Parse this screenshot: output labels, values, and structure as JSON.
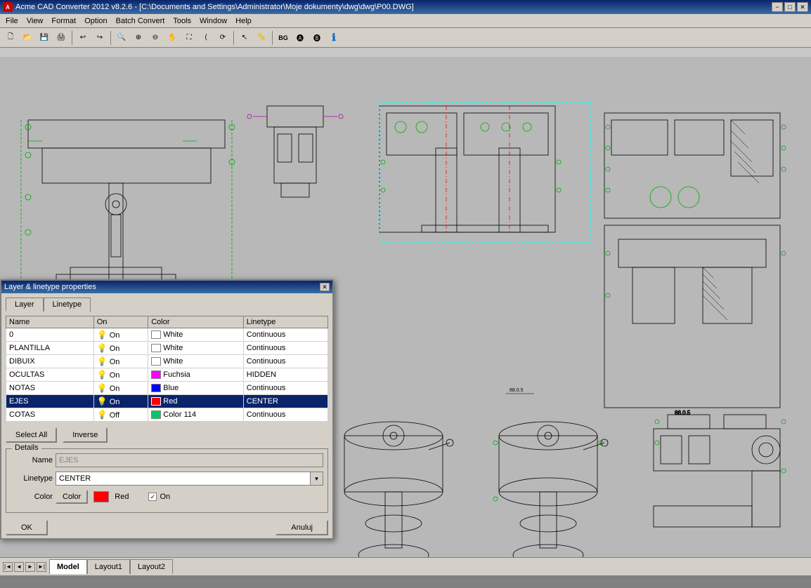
{
  "title": {
    "app_name": "Acme CAD Converter 2012 v8.2.6",
    "file_path": "C:\\Documents and Settings\\Administrator\\Moje dokumenty\\dwg\\dwg\\P00.DWG",
    "full_title": "Acme CAD Converter 2012 v8.2.6 - [C:\\Documents and Settings\\Administrator\\Moje dokumenty\\dwg\\dwg\\P00.DWG]"
  },
  "title_buttons": {
    "minimize": "−",
    "maximize": "□",
    "close": "✕"
  },
  "menu": {
    "items": [
      "File",
      "View",
      "Format",
      "Option",
      "Batch Convert",
      "Tools",
      "Window",
      "Help"
    ]
  },
  "dialog": {
    "title": "Layer & linetype properties",
    "tabs": [
      {
        "label": "Layer",
        "active": true
      },
      {
        "label": "Linetype",
        "active": false
      }
    ],
    "table": {
      "headers": [
        "Name",
        "On",
        "Color",
        "Linetype"
      ],
      "rows": [
        {
          "name": "0",
          "on": "On",
          "color_name": "White",
          "color_hex": "#ffffff",
          "linetype": "Continuous",
          "selected": false
        },
        {
          "name": "PLANTILLA",
          "on": "On",
          "color_name": "White",
          "color_hex": "#ffffff",
          "linetype": "Continuous",
          "selected": false
        },
        {
          "name": "DIBUIX",
          "on": "On",
          "color_name": "White",
          "color_hex": "#ffffff",
          "linetype": "Continuous",
          "selected": false
        },
        {
          "name": "OCULTAS",
          "on": "On",
          "color_name": "Fuchsia",
          "color_hex": "#ff00ff",
          "linetype": "HIDDEN",
          "selected": false
        },
        {
          "name": "NOTAS",
          "on": "On",
          "color_name": "Blue",
          "color_hex": "#0000ff",
          "linetype": "Continuous",
          "selected": false
        },
        {
          "name": "EJES",
          "on": "On",
          "color_name": "Red",
          "color_hex": "#ff0000",
          "linetype": "CENTER",
          "selected": true
        },
        {
          "name": "COTAS",
          "on": "Off",
          "color_name": "Color 114",
          "color_hex": "#00cc66",
          "linetype": "Continuous",
          "selected": false
        }
      ]
    },
    "buttons": {
      "select_all": "Select All",
      "inverse": "Inverse"
    },
    "details": {
      "legend": "Details",
      "name_label": "Name",
      "name_value": "EJES",
      "linetype_label": "Linetype",
      "linetype_value": "CENTER",
      "color_label": "Color",
      "color_btn": "Color",
      "color_swatch": "#ff0000",
      "color_name": "Red",
      "on_label": "On",
      "on_checked": true
    },
    "footer": {
      "ok": "OK",
      "cancel": "Anuluj"
    }
  },
  "tabs": {
    "model": "Model",
    "layout1": "Layout1",
    "layout2": "Layout2"
  },
  "colors": {
    "accent": "#0a246a",
    "dialog_bg": "#d4d0c8",
    "selected_row_bg": "#0a246a"
  }
}
